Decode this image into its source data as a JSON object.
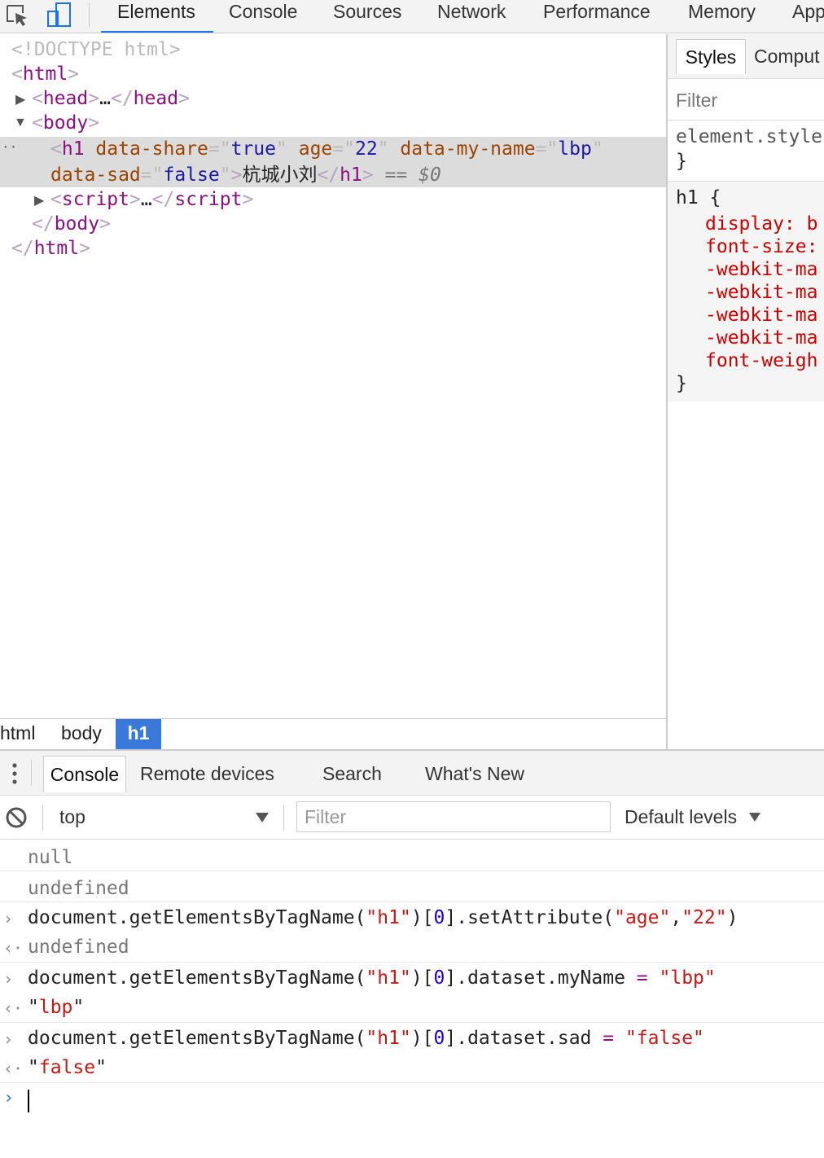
{
  "toolbar": {
    "tabs": [
      "Elements",
      "Console",
      "Sources",
      "Network",
      "Performance",
      "Memory",
      "App"
    ],
    "active_tab": "Elements"
  },
  "elements_tree": {
    "doctype": "<!DOCTYPE html>",
    "html_open": "html",
    "head": "head",
    "head_ellipsis": "…",
    "body": "body",
    "h1": {
      "tag": "h1",
      "attrs": [
        {
          "name": "data-share",
          "value": "true"
        },
        {
          "name": "age",
          "value": "22"
        },
        {
          "name": "data-my-name",
          "value": "lbp"
        },
        {
          "name": "data-sad",
          "value": "false"
        }
      ],
      "text": "杭城小刘",
      "selected_marker": "== $0"
    },
    "script": "script",
    "script_ellipsis": "…"
  },
  "breadcrumb": [
    "html",
    "body",
    "h1"
  ],
  "styles_sidebar": {
    "tabs": [
      "Styles",
      "Comput"
    ],
    "filter_placeholder": "Filter",
    "element_style": "element.style",
    "brace_open_1": "{",
    "brace_close": "}",
    "rule_selector": "h1 {",
    "properties": [
      "display: b",
      "font-size:",
      "-webkit-ma",
      "-webkit-ma",
      "-webkit-ma",
      "-webkit-ma",
      "font-weigh"
    ]
  },
  "drawer": {
    "tabs": [
      "Console",
      "Remote devices",
      "Search",
      "What's New"
    ],
    "context": "top",
    "filter_placeholder": "Filter",
    "levels": "Default levels"
  },
  "console": {
    "lines": [
      {
        "kind": "output",
        "text": "null"
      },
      {
        "kind": "output",
        "text": "undefined"
      },
      {
        "kind": "input",
        "text": "document.getElementsByTagName(\"h1\")[0].setAttribute(\"age\",\"22\")"
      },
      {
        "kind": "result",
        "text": "undefined"
      },
      {
        "kind": "input",
        "text": "document.getElementsByTagName(\"h1\")[0].dataset.myName = \"lbp\""
      },
      {
        "kind": "result",
        "text": "\"lbp\""
      },
      {
        "kind": "input",
        "text": "document.getElementsByTagName(\"h1\")[0].dataset.sad = \"false\""
      },
      {
        "kind": "result",
        "text": "\"false\""
      }
    ]
  },
  "colors": {
    "accent": "#1a73e8",
    "breadcrumb_selected": "#3879d9",
    "tag": "#881280",
    "attr_name": "#994500",
    "attr_value": "#1a1aa6",
    "string": "#c41a16"
  },
  "icons": [
    "inspect-element-icon",
    "device-toolbar-icon",
    "drawer-menu-icon",
    "clear-console-icon",
    "dropdown-arrow-icon",
    "expand-triangle-icon",
    "collapse-triangle-icon",
    "prompt-arrow-icon",
    "result-arrow-icon"
  ]
}
